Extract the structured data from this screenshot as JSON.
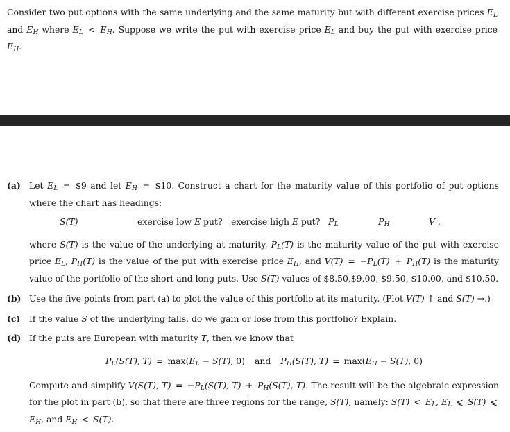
{
  "document": {
    "background_color": "#ffffff",
    "text_color": "#16161c",
    "band_color": "#262626"
  },
  "intro": {
    "line1_a": "Consider two put options with the same underlying and the same maturity but with different exercise prices ",
    "E_L": "E",
    "sub_L": "L",
    "line1_b": " and ",
    "E_H": "E",
    "sub_H": "H",
    "line1_c": " where ",
    "lt": " < ",
    "line1_d": ". Suppose we write the put with exercise price ",
    "line1_e": " and buy the put with exercise price ",
    "line1_f": "."
  },
  "items": {
    "a": {
      "label": "(a)",
      "text_1": "Let ",
      "eq_EL": "E",
      "sub_L": "L",
      "eq_eq": " = ",
      "val_EL": "$9",
      "text_2": " and let ",
      "eq_EH": "E",
      "sub_H": "H",
      "val_EH": "$10",
      "text_3": ". Construct a chart for the maturity value of this portfolio of put options where the chart has headings:",
      "headings": [
        "S(T)",
        "exercise low E put?",
        "exercise high E put?",
        "P_L",
        "P_H",
        "V ,"
      ],
      "heading_1_math": "S",
      "heading_1_paren": "(T)",
      "heading_2_pre": "exercise low ",
      "heading_2_E": "E",
      "heading_2_post": " put?",
      "heading_3_pre": "exercise high ",
      "heading_3_E": "E",
      "heading_3_post": " put?",
      "heading_4_P": "P",
      "heading_4_sub": "L",
      "heading_5_P": "P",
      "heading_5_sub": "H",
      "heading_6_V": "V",
      "heading_6_comma": ",",
      "where_1": "where ",
      "where_2": " is the value of the underlying at maturity, ",
      "where_3": " is the maturity value of the put with exercise price ",
      "where_4": ", ",
      "where_5": " is the value of the put with exercise price ",
      "where_6": ", and ",
      "where_7": " is the maturity value of the portfolio of the short and long puts. Use ",
      "where_8": " values of $8.50,$9.00, $9.50, $10.00, and $10.50.",
      "ST": "S(T)",
      "PLT": "P",
      "PLT_sub": "L",
      "PLT_paren": "(T)",
      "PHT": "P",
      "PHT_sub": "H",
      "PHT_paren": "(T)",
      "VT": "V",
      "VT_paren": "(T)",
      "VT_eq": " = ",
      "VT_rhs_minus": "−",
      "VT_rhs_plus": " + "
    },
    "b": {
      "label": "(b)",
      "text_1": "Use the five points from part (a) to plot the value of this portfolio at its maturity. (Plot ",
      "VT": "V",
      "VT_paren": "(T)",
      "up_arrow": "↑",
      "text_2": " and ",
      "ST": "S",
      "ST_paren": "(T)",
      "right_arrow": "→",
      "text_3": ".)"
    },
    "c": {
      "label": "(c)",
      "text_1": "If the value ",
      "S": "S",
      "text_2": " of the underlying falls, do we gain or lose from this portfolio?  Explain."
    },
    "d": {
      "label": "(d)",
      "text_1": "If the puts are European with maturity ",
      "T": "T",
      "text_2": ", then we know that",
      "equation": {
        "lhs_P": "P",
        "lhs_sub": "L",
        "lhs_args": "(S(T), T)",
        "eq": " = ",
        "max": "max",
        "max_open": "(",
        "max_E": "E",
        "max_E_sub": "L",
        "minus": " − ",
        "max_ST": "S(T)",
        "comma_zero": ", 0)",
        "and": "and",
        "rhs_P": "P",
        "rhs_sub": "H",
        "rhs_args": "(S(T), T)",
        "rhs_max_E": "E",
        "rhs_max_E_sub": "H"
      },
      "closing": {
        "t1": "Compute and simplify ",
        "V": "V",
        "V_args": "(S(T), T)",
        "eq": " = ",
        "minus": "−",
        "PL": "P",
        "PL_sub": "L",
        "PL_args": "(S(T), T)",
        "plus": " + ",
        "PH": "P",
        "PH_sub": "H",
        "PH_args": "(S(T), T)",
        "t2": ".  The result will be the algebraic expression for the plot in part (b), so that there are three regions for the range, ",
        "ST": "S(T)",
        "t3": ", namely: ",
        "r1_ST": "S(T)",
        "r1_lt": " < ",
        "r1_EL": "E",
        "r1_EL_sub": "L",
        "comma1": ", ",
        "r2_EL": "E",
        "r2_EL_sub": "L",
        "r2_le": " ⩽ ",
        "r2_ST": "S(T)",
        "r2_le2": " ⩽ ",
        "r2_EH": "E",
        "r2_EH_sub": "H",
        "comma2": ", and ",
        "r3_EH": "E",
        "r3_EH_sub": "H",
        "r3_lt": " < ",
        "r3_ST": "S(T)",
        "period": "."
      }
    }
  }
}
